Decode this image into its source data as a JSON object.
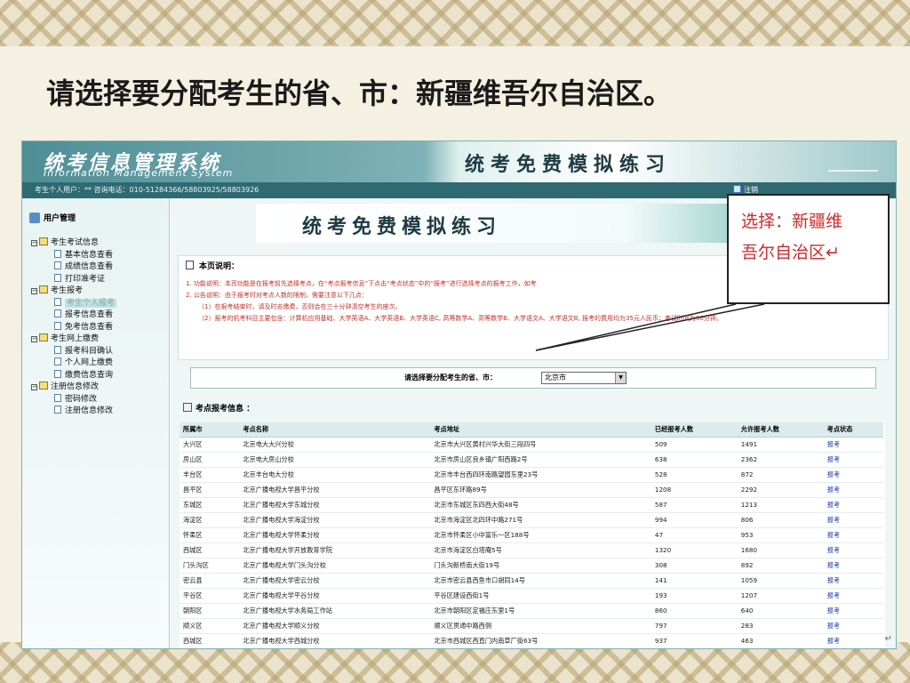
{
  "slide": {
    "title": "请选择要分配考生的省、市：新疆维吾尔自治区。",
    "callout": [
      "选择：新疆维",
      "吾尔自治区↵"
    ],
    "para_mark": "↵"
  },
  "app": {
    "system_name_cn": "统考信息管理系统",
    "system_name_en": "Information Management System",
    "header_banner": "统考免费模拟练习",
    "user_info": "考生个人用户：** 咨询电话：010-51284366/58803925/58803926",
    "logout": "注销"
  },
  "sidebar": {
    "title": "用户管理",
    "tree": [
      {
        "label": "考生考试信息",
        "level": 0
      },
      {
        "label": "基本信息查看",
        "level": 1
      },
      {
        "label": "成绩信息查看",
        "level": 1
      },
      {
        "label": "打印准考证",
        "level": 1
      },
      {
        "label": "考生报考",
        "level": 0
      },
      {
        "label": "考生个人报考",
        "level": 1,
        "selected": true
      },
      {
        "label": "报考信息查看",
        "level": 1
      },
      {
        "label": "免考信息查看",
        "level": 1
      },
      {
        "label": "考生网上缴费",
        "level": 0
      },
      {
        "label": "报考科目确认",
        "level": 1
      },
      {
        "label": "个人网上缴费",
        "level": 1
      },
      {
        "label": "缴费信息查询",
        "level": 1
      },
      {
        "label": "注册信息修改",
        "level": 0
      },
      {
        "label": "密码修改",
        "level": 1
      },
      {
        "label": "注册信息修改",
        "level": 1
      }
    ]
  },
  "main": {
    "banner": "统考免费模拟练习",
    "notice_title": "本页说明：",
    "notice_lines": [
      "1. 功能说明：本页功能是在报考前先选择考点，在“考点报考信息”下点击“考点状态”中的“报考”进行选择考点的报考工作，如考",
      "2. 公告说明：由于报考时对考点人数的限制，需要注意以下几点：",
      "（1）在报考结束时，请及时去缴费，否则会在三十分钟清空考生的座次。",
      "（2）报考的机考科目主要包含：计算机应用基础、大学英语A、大学英语B、大学英语C, 高等数学A、高等数学B、大学语文A、大学语文B, 报考的费用均为35元人民币；考试时间为90分钟。"
    ],
    "select_label": "请选择要分配考生的省、市：",
    "select_value": "北京市",
    "exam_section_title": "考点报考信息 ：",
    "table": {
      "headers": [
        "所属市",
        "考点名称",
        "考点地址",
        "已经报考人数",
        "允许报考人数",
        "考点状态"
      ],
      "rows": [
        [
          "大兴区",
          "北京电大大兴分校",
          "北京市大兴区黄村兴华大街三段四号",
          "509",
          "1491",
          "报考"
        ],
        [
          "房山区",
          "北京电大房山分校",
          "北京市房山区良乡镇广阳西路2号",
          "638",
          "2362",
          "报考"
        ],
        [
          "丰台区",
          "北京丰台电大分校",
          "北京市丰台西四环南路望园东里23号",
          "528",
          "872",
          "报考"
        ],
        [
          "昌平区",
          "北京广播电视大学昌平分校",
          "昌平区东环路89号",
          "1208",
          "2292",
          "报考"
        ],
        [
          "东城区",
          "北京广播电视大学东城分校",
          "北京市东城区东四西大街48号",
          "587",
          "1213",
          "报考"
        ],
        [
          "海淀区",
          "北京广播电视大学海淀分校",
          "北京市海淀区北四环中路271号",
          "994",
          "806",
          "报考"
        ],
        [
          "怀柔区",
          "北京广播电视大学怀柔分校",
          "北京市怀柔区小中富乐一区188号",
          "47",
          "953",
          "报考"
        ],
        [
          "西城区",
          "北京广播电视大学开放教育学院",
          "北京市海淀区白塔庵5号",
          "1320",
          "1680",
          "报考"
        ],
        [
          "门头沟区",
          "北京广播电视大学门头沟分校",
          "门头沟新桥南大街19号",
          "308",
          "892",
          "报考"
        ],
        [
          "密云县",
          "北京广播电视大学密云分校",
          "北京市密云县西鱼市口胡同14号",
          "141",
          "1059",
          "报考"
        ],
        [
          "平谷区",
          "北京广播电视大学平谷分校",
          "平谷区建设西街1号",
          "193",
          "1207",
          "报考"
        ],
        [
          "朝阳区",
          "北京广播电视大学水务局工作站",
          "北京市朝阳区定福庄东里1号",
          "860",
          "640",
          "报考"
        ],
        [
          "顺义区",
          "北京广播电视大学顺义分校",
          "顺义区贯通中路西侧",
          "797",
          "283",
          "报考"
        ],
        [
          "西城区",
          "北京广播电视大学西城分校",
          "北京市西城区西直门内南草厂街63号",
          "937",
          "463",
          "报考"
        ]
      ]
    }
  }
}
